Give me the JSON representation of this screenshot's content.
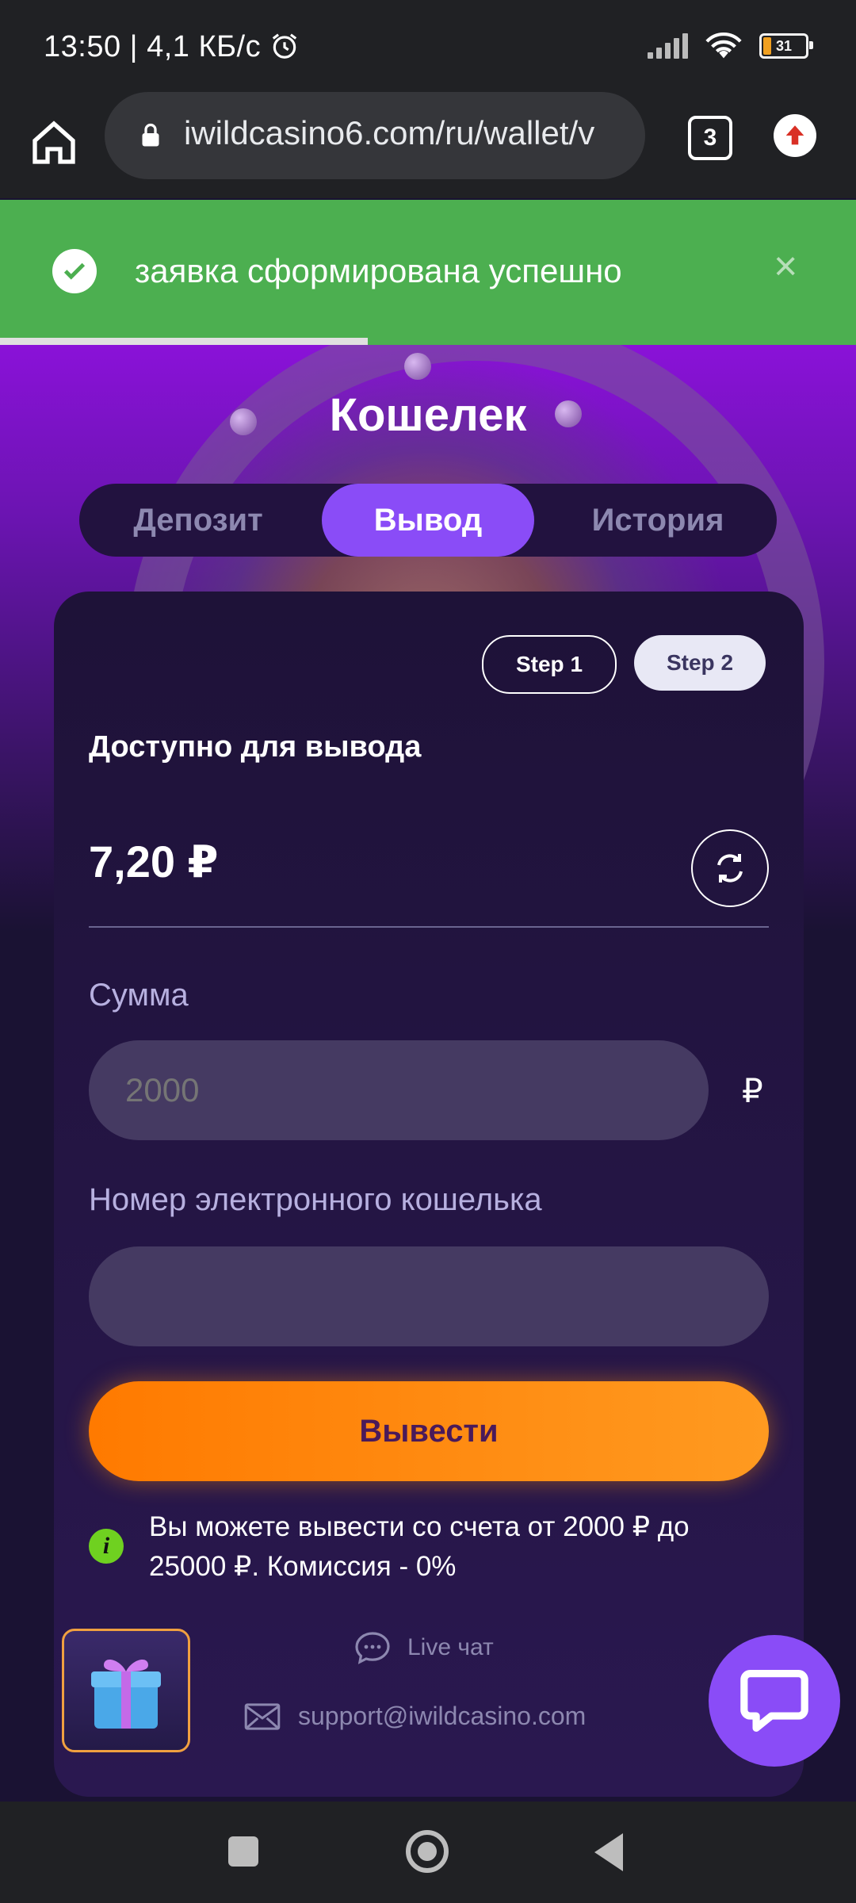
{
  "status_bar": {
    "time_speed": "13:50 | 4,1 КБ/с",
    "battery_level": "31",
    "icons": [
      "alarm-icon",
      "signal-icon",
      "wifi-icon",
      "battery-icon"
    ]
  },
  "browser": {
    "url": "iwildcasino6.com/ru/wallet/v",
    "tab_count": "3"
  },
  "notification": {
    "text": "заявка сформирована успешно",
    "close": "×",
    "progress": 0.43
  },
  "page": {
    "title": "Кошелек"
  },
  "tabs": [
    {
      "label": "Депозит",
      "active": false
    },
    {
      "label": "Вывод",
      "active": true
    },
    {
      "label": "История",
      "active": false
    }
  ],
  "steps": [
    "Step 1",
    "Step 2"
  ],
  "withdraw": {
    "available_label": "Доступно для вывода",
    "balance": "7,20 ₽",
    "sum_label": "Сумма",
    "sum_placeholder": "2000",
    "currency": "₽",
    "wallet_label": "Номер электронного кошелька",
    "wallet_value": "",
    "submit": "Вывести",
    "info": "Вы можете вывести со счета от 2000 ₽ до 25000 ₽. Комиссия - 0%"
  },
  "footer": {
    "live_chat": "Live чат",
    "support_email": "support@iwildcasino.com"
  },
  "colors": {
    "accent": "#8a4cf7",
    "success": "#4caf50",
    "submit": "#ff8a10",
    "card": "#1e1238"
  }
}
